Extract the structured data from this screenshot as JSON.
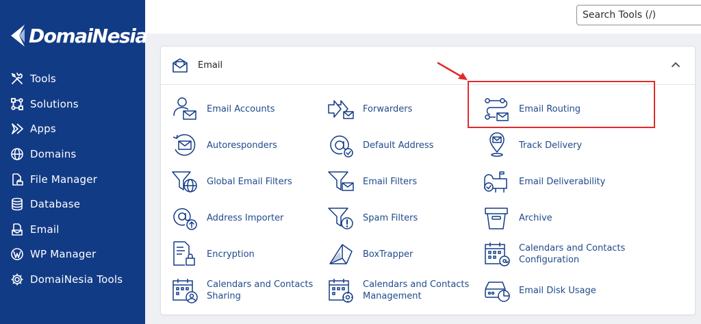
{
  "brand": {
    "name": "DomaiNesia"
  },
  "sidebar": {
    "items": [
      {
        "label": "Tools",
        "icon": "tools-icon"
      },
      {
        "label": "Solutions",
        "icon": "solutions-icon"
      },
      {
        "label": "Apps",
        "icon": "apps-icon"
      },
      {
        "label": "Domains",
        "icon": "globe-icon"
      },
      {
        "label": "File Manager",
        "icon": "file-manager-icon"
      },
      {
        "label": "Database",
        "icon": "database-icon"
      },
      {
        "label": "Email",
        "icon": "email-icon"
      },
      {
        "label": "WP Manager",
        "icon": "wordpress-icon"
      },
      {
        "label": "DomaiNesia Tools",
        "icon": "gear-icon"
      }
    ]
  },
  "search": {
    "placeholder": "Search Tools (/)"
  },
  "panel": {
    "title": "Email",
    "tools": [
      {
        "label": "Email Accounts",
        "icon": "email-accounts-icon"
      },
      {
        "label": "Forwarders",
        "icon": "forwarders-icon"
      },
      {
        "label": "Email Routing",
        "icon": "email-routing-icon"
      },
      {
        "label": "Autoresponders",
        "icon": "autoresponders-icon"
      },
      {
        "label": "Default Address",
        "icon": "default-address-icon"
      },
      {
        "label": "Track Delivery",
        "icon": "track-delivery-icon"
      },
      {
        "label": "Global Email Filters",
        "icon": "global-filters-icon"
      },
      {
        "label": "Email Filters",
        "icon": "email-filters-icon"
      },
      {
        "label": "Email Deliverability",
        "icon": "deliverability-icon"
      },
      {
        "label": "Address Importer",
        "icon": "address-importer-icon"
      },
      {
        "label": "Spam Filters",
        "icon": "spam-filters-icon"
      },
      {
        "label": "Archive",
        "icon": "archive-icon"
      },
      {
        "label": "Encryption",
        "icon": "encryption-icon"
      },
      {
        "label": "BoxTrapper",
        "icon": "boxtrapper-icon"
      },
      {
        "label": "Calendars and Contacts Configuration",
        "icon": "calendar-config-icon"
      },
      {
        "label": "Calendars and Contacts Sharing",
        "icon": "calendar-sharing-icon"
      },
      {
        "label": "Calendars and Contacts Management",
        "icon": "calendar-management-icon"
      },
      {
        "label": "Email Disk Usage",
        "icon": "disk-usage-icon"
      }
    ]
  },
  "colors": {
    "sidebar": "#123b86",
    "link": "#1f4a8a",
    "icon": "#123b86",
    "highlight": "#e02b2b"
  }
}
